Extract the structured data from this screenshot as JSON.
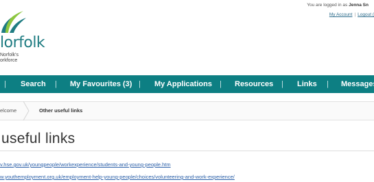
{
  "account": {
    "logged_in_prefix": "You are logged in as",
    "user_name": "Jenna Sn",
    "my_account": "My Account",
    "logout": "Logout ("
  },
  "logo": {
    "wordmark": "lorfolk",
    "tagline_line1": "Norfolk's",
    "tagline_line2": "orkforce"
  },
  "nav": {
    "separator": "|",
    "items": [
      {
        "label": "Search"
      },
      {
        "label": "My Favourites (3)"
      },
      {
        "label": "My Applications"
      },
      {
        "label": "Resources"
      },
      {
        "label": "Links"
      },
      {
        "label": "Messages"
      }
    ]
  },
  "breadcrumb": {
    "home": "elcome",
    "current": "Other useful links"
  },
  "page": {
    "title": "useful links",
    "links": [
      {
        "text": "v.hse.gov.uk/youngpeople/workexperience/students-and-young-people.htm"
      },
      {
        "text": "w.youthemployment.org.uk/employment-help-young-people/choices/volunteering-and-work-experience/"
      }
    ]
  },
  "colors": {
    "nav_background": "#0d7f83",
    "link": "#2a5fa8",
    "brand_teal": "#1f7c82",
    "brand_green": "#8cc63f"
  },
  "icons": {
    "logo_mark": "leaf-swoosh-icon",
    "breadcrumb_separator": "chevron-right-icon"
  }
}
